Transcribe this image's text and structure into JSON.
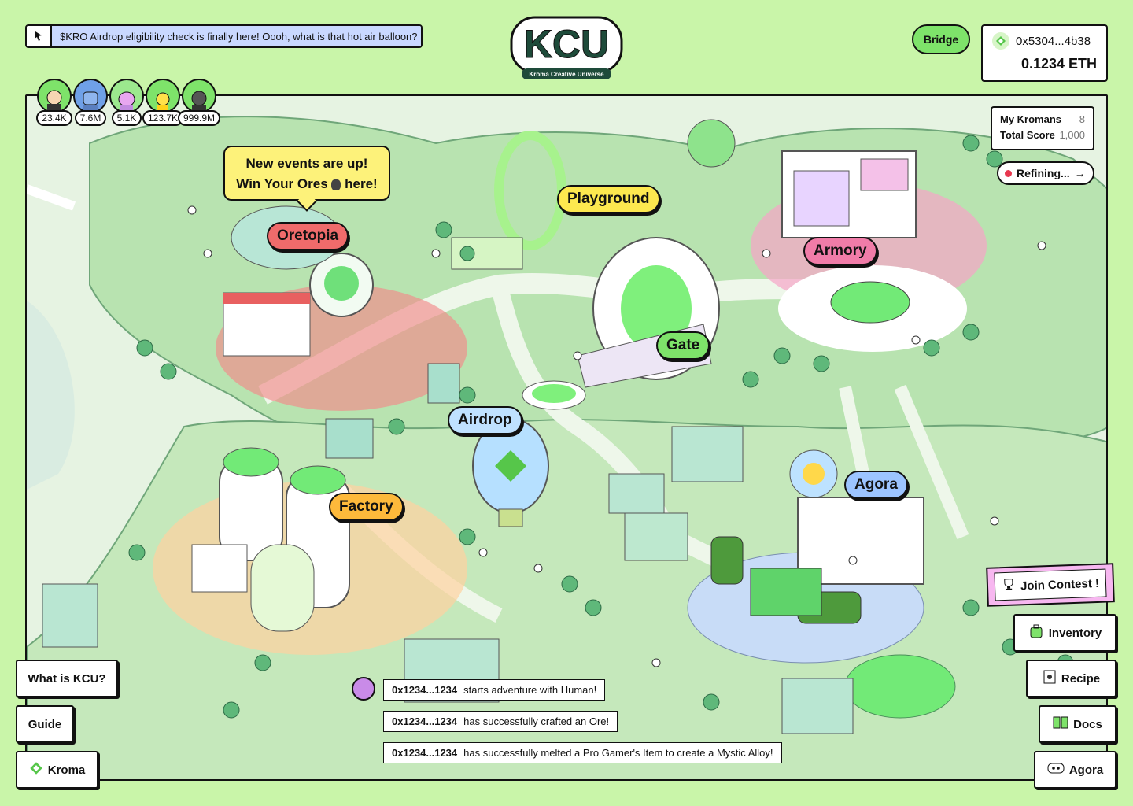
{
  "announcement": "$KRO Airdrop eligibility check is finally here! Oooh, what is that hot air balloon?",
  "logo": {
    "mark": "KCU",
    "tagline": "Kroma Creative Universe"
  },
  "header": {
    "bridge_label": "Bridge",
    "wallet_address": "0x5304...4b38",
    "wallet_balance": "0.1234 ETH"
  },
  "avatars": [
    {
      "count": "23.4K"
    },
    {
      "count": "7.6M"
    },
    {
      "count": "5.1K"
    },
    {
      "count": "123.7K"
    },
    {
      "count": "999.9M"
    }
  ],
  "kromans": {
    "my_label": "My Kromans",
    "my_value": "8",
    "score_label": "Total Score",
    "score_value": "1,000"
  },
  "refining_label": "Refining...",
  "event_bubble": {
    "line1": "New events are up!",
    "line2a": "Win Your Ores",
    "line2b": "here!"
  },
  "locations": {
    "oretopia": "Oretopia",
    "playground": "Playground",
    "armory": "Armory",
    "gate": "Gate",
    "airdrop": "Airdrop",
    "factory": "Factory",
    "agora": "Agora"
  },
  "left_buttons": {
    "what": "What is KCU?",
    "guide": "Guide",
    "kroma": "Kroma"
  },
  "right_buttons": {
    "contest": "Join Contest !",
    "inventory": "Inventory",
    "recipe": "Recipe",
    "docs": "Docs",
    "agora": "Agora"
  },
  "feed": [
    {
      "user": "0x1234...1234",
      "text": "starts adventure with Human!"
    },
    {
      "user": "0x1234...1234",
      "text": "has successfully crafted an Ore!"
    },
    {
      "user": "0x1234...1234",
      "text": "has successfully melted a Pro Gamer's Item to create a Mystic Alloy!"
    }
  ]
}
